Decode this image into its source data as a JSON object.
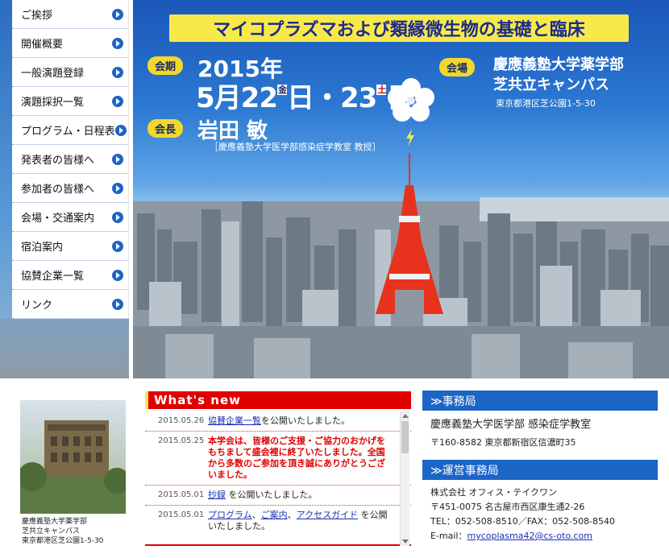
{
  "nav": {
    "items": [
      {
        "label": "ご挨拶"
      },
      {
        "label": "開催概要"
      },
      {
        "label": "一般演題登録"
      },
      {
        "label": "演題採択一覧"
      },
      {
        "label": "プログラム・日程表"
      },
      {
        "label": "発表者の皆様へ"
      },
      {
        "label": "参加者の皆様へ"
      },
      {
        "label": "会場・交通案内"
      },
      {
        "label": "宿泊案内"
      },
      {
        "label": "協賛企業一覧"
      },
      {
        "label": "リンク"
      }
    ]
  },
  "hero": {
    "title": "マイコプラズマおよび類縁微生物の基礎と臨床",
    "period_label": "会期",
    "year": "2015年",
    "month": "5月",
    "day1": "22",
    "day1_weekday": "金",
    "day_separator": "日・",
    "day2": "23",
    "day2_weekday": "土",
    "day_suffix": "日",
    "chair_label": "会長",
    "chair_name": "岩田 敏",
    "chair_affiliation": "［慶應義塾大学医学部感染症学教室 教授］",
    "venue_label": "会場",
    "venue_line1": "慶應義塾大学薬学部",
    "venue_line2": "芝共立キャンパス",
    "venue_address": "東京都港区芝公園1-5-30"
  },
  "building": {
    "caption1": "慶應義塾大学薬学部",
    "caption2": "芝共立キャンパス",
    "caption3": "東京都港区芝公園1-5-30"
  },
  "news": {
    "header": "What's new",
    "items": [
      {
        "date": "2015.05.26",
        "link": "協賛企業一覧",
        "text": "を公開いたしました。"
      },
      {
        "date": "2015.05.25",
        "alert": "本学会は、皆様のご支援・ご協力のおかげをもちまして盛会裡に終了いたしました。全国から多数のご参加を頂き誠にありがとうございました。"
      },
      {
        "date": "2015.05.01",
        "link": "抄録",
        "text": " を公開いたしました。"
      },
      {
        "date": "2015.05.01",
        "links": [
          "プログラム",
          "ご案内",
          "アクセスガイド"
        ],
        "sep": "、",
        "text": " を公開いたしました。"
      }
    ]
  },
  "office": {
    "header": "≫事務局",
    "name": "慶應義塾大学医学部 感染症学教室",
    "address": "〒160-8582 東京都新宿区信濃町35"
  },
  "operations": {
    "header": "≫運営事務局",
    "name": "株式会社 オフィス・テイクワン",
    "address": "〒451-0075 名古屋市西区康生通2-26",
    "tel": "TEL：052-508-8510／FAX：052-508-8540",
    "email_label": "E-mail：",
    "email": "mycoplasma42@cs-oto.com"
  },
  "colors": {
    "nav_arrow": "#1e64c8",
    "title_band": "#f7e94a",
    "news_red": "#e10000",
    "office_blue": "#1b65c7",
    "tokyo_tower": "#e8321e"
  }
}
